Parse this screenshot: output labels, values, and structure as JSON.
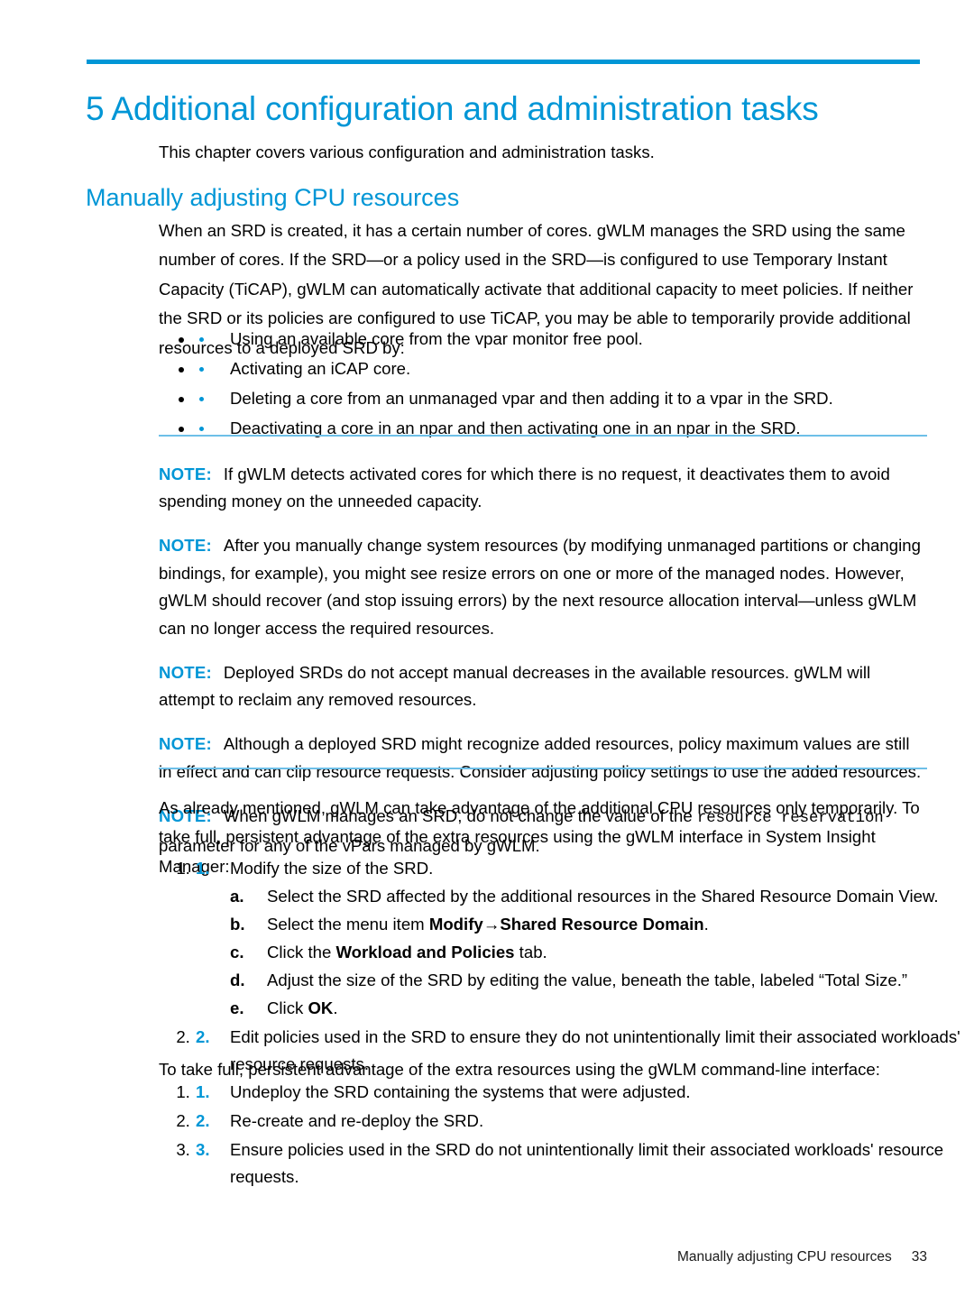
{
  "chapter": {
    "title": "5 Additional configuration and administration tasks",
    "intro": "This chapter covers various configuration and administration tasks.",
    "accent_color": "#0096D6",
    "rule_color": "#0096D6",
    "note_rule_color": "#6DBFE8"
  },
  "section": {
    "title": "Manually adjusting CPU resources",
    "paragraph": "When an SRD is created, it has a certain number of cores. gWLM manages the SRD using the same number of cores. If the SRD—or a policy used in the SRD—is configured to use Temporary Instant Capacity (TiCAP), gWLM can automatically activate that additional capacity to meet policies. If neither the SRD or its policies are configured to use TiCAP, you may be able to temporarily provide additional resources to a deployed SRD by:"
  },
  "bullets": [
    "Using an available core from the vpar monitor free pool.",
    "Activating an iCAP core.",
    "Deleting a core from an unmanaged vpar and then adding it to a vpar in the SRD.",
    "Deactivating a core in an npar and then activating one in an npar in the SRD."
  ],
  "notes": [
    {
      "label": "NOTE:",
      "text": "If gWLM detects activated cores for which there is no request, it deactivates them to avoid spending money on the unneeded capacity."
    },
    {
      "label": "NOTE:",
      "text": "After you manually change system resources (by modifying unmanaged partitions or changing bindings, for example), you might see resize errors on one or more of the managed nodes. However, gWLM should recover (and stop issuing errors) by the next resource allocation interval—unless gWLM can no longer access the required resources."
    },
    {
      "label": "NOTE:",
      "text": "Deployed SRDs do not accept manual decreases in the available resources. gWLM will attempt to reclaim any removed resources."
    },
    {
      "label": "NOTE:",
      "text": "Although a deployed SRD might recognize added resources, policy maximum values are still in effect and can clip resource requests. Consider adjusting policy settings to use the added resources."
    },
    {
      "label": "NOTE:",
      "text_before": "When gWLM manages an SRD, do not change the value of the ",
      "code": "resource reservation",
      "text_after": " parameter for any of the vPars managed by gWLM."
    }
  ],
  "sim_section": {
    "paragraph": "As already mentioned, gWLM can take advantage of the additional CPU resources only temporarily. To take full, persistent advantage of the extra resources using the gWLM interface in System Insight Manager:",
    "steps": [
      {
        "marker": "1.",
        "text": "Modify the size of the SRD.",
        "substeps": [
          {
            "marker": "a.",
            "text": "Select the SRD affected by the additional resources in the Shared Resource Domain View."
          },
          {
            "marker": "b.",
            "text_before": "Select the menu item ",
            "bold1": "Modify",
            "arrow": "→",
            "bold2": "Shared Resource Domain",
            "text_after": "."
          },
          {
            "marker": "c.",
            "text_before": "Click the ",
            "bold1": "Workload and Policies",
            "text_after": " tab."
          },
          {
            "marker": "d.",
            "text": "Adjust the size of the SRD by editing the value, beneath the table, labeled “Total Size.”"
          },
          {
            "marker": "e.",
            "text_before": "Click ",
            "bold1": "OK",
            "text_after": "."
          }
        ]
      },
      {
        "marker": "2.",
        "text": "Edit policies used in the SRD to ensure they do not unintentionally limit their associated workloads' resource requests.",
        "substeps": []
      }
    ]
  },
  "cli_section": {
    "lead": "To take full, persistent advantage of the extra resources using the gWLM command-line interface:",
    "steps": [
      {
        "marker": "1.",
        "text": "Undeploy the SRD containing the systems that were adjusted."
      },
      {
        "marker": "2.",
        "text": "Re-create and re-deploy the SRD."
      },
      {
        "marker": "3.",
        "text": "Ensure policies used in the SRD do not unintentionally limit their associated workloads' resource requests."
      }
    ]
  },
  "footer": {
    "running_head": "Manually adjusting CPU resources",
    "page_number": "33"
  }
}
